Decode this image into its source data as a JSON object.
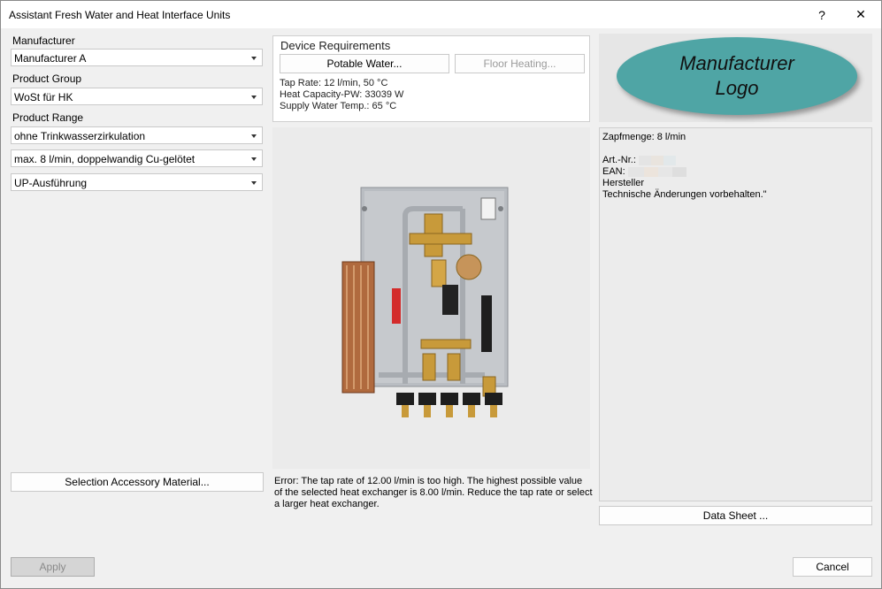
{
  "window": {
    "title": "Assistant Fresh Water and Heat Interface Units",
    "help_glyph": "?",
    "close_glyph": "✕"
  },
  "left": {
    "manufacturer_label": "Manufacturer",
    "manufacturer_value": "Manufacturer A",
    "product_group_label": "Product Group",
    "product_group_value": "WoSt für HK",
    "product_range_label": "Product Range",
    "range_option_1": "ohne Trinkwasserzirkulation",
    "range_option_2": "max.   8 l/min, doppelwandig Cu-gelötet",
    "range_option_3": "UP-Ausführung",
    "accessory_button": "Selection Accessory Material..."
  },
  "requirements": {
    "title": "Device Requirements",
    "potable_button": "Potable Water...",
    "floor_button": "Floor Heating...",
    "tap_rate": "Tap Rate: 12 l/min, 50 °C",
    "heat_capacity": "Heat Capacity-PW: 33039 W",
    "supply_temp": "Supply Water Temp.: 65 °C"
  },
  "error_text": "Error: The tap rate of 12.00 l/min is too high. The highest possible value of the selected heat exchanger is 8.00 l/min. Reduce the tap rate or select a larger heat exchanger.",
  "logo": {
    "line1": "Manufacturer",
    "line2": "Logo"
  },
  "info": {
    "zapfmenge": "Zapfmenge: 8 l/min",
    "art_nr": "Art.-Nr.:",
    "ean": "EAN:",
    "hersteller": "Hersteller",
    "technische": "Technische Änderungen vorbehalten.\""
  },
  "data_sheet_button": "Data Sheet ...",
  "apply_button": "Apply",
  "cancel_button": "Cancel",
  "colors": {
    "logo_fill": "#4fa5a5",
    "window_bg": "#f0f0f0"
  }
}
